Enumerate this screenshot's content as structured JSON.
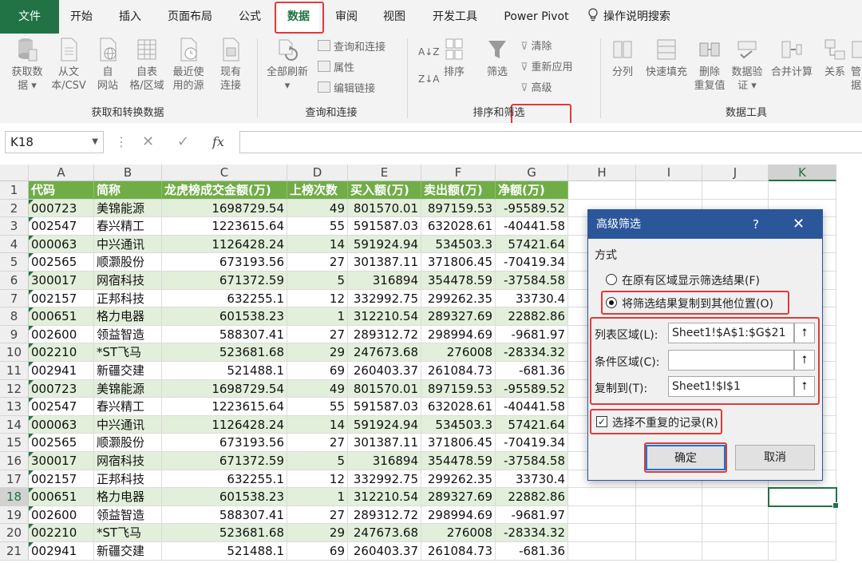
{
  "menu": {
    "items": [
      "文件",
      "开始",
      "插入",
      "页面布局",
      "公式",
      "数据",
      "审阅",
      "视图",
      "开发工具",
      "Power Pivot"
    ],
    "search_label": "操作说明搜索",
    "active": "数据"
  },
  "ribbon": {
    "get_transform": {
      "buttons": [
        {
          "line1": "获取数",
          "line2": "据 ▾"
        },
        {
          "line1": "从文",
          "line2": "本/CSV"
        },
        {
          "line1": "自",
          "line2": "网站"
        },
        {
          "line1": "自表",
          "line2": "格/区域"
        },
        {
          "line1": "最近使",
          "line2": "用的源"
        },
        {
          "line1": "现有",
          "line2": "连接"
        }
      ],
      "label": "获取和转换数据"
    },
    "queries": {
      "refresh": {
        "line1": "全部刷新",
        "line2": "▾"
      },
      "small": [
        "查询和连接",
        "属性",
        "编辑链接"
      ],
      "label": "查询和连接"
    },
    "sort_filter": {
      "sort_asc": "A↓Z",
      "sort_desc": "Z↓A",
      "sort": "排序",
      "filter": "筛选",
      "clear": "清除",
      "reapply": "重新应用",
      "advanced": "高级",
      "label": "排序和筛选"
    },
    "data_tools": {
      "buttons": [
        {
          "line1": "分列",
          "line2": ""
        },
        {
          "line1": "快速填充",
          "line2": ""
        },
        {
          "line1": "删除",
          "line2": "重复值"
        },
        {
          "line1": "数据验",
          "line2": "证 ▾"
        },
        {
          "line1": "合并计算",
          "line2": ""
        },
        {
          "line1": "关系",
          "line2": ""
        },
        {
          "line1": "管",
          "line2": "据"
        }
      ],
      "label": "数据工具"
    }
  },
  "formula_bar": {
    "name_box": "K18",
    "fx": "fx",
    "cancel": "✕",
    "enter": "✓",
    "dots": "⋮",
    "value": ""
  },
  "sheet": {
    "columns": [
      "A",
      "B",
      "C",
      "D",
      "E",
      "F",
      "G",
      "H",
      "I",
      "J",
      "K"
    ],
    "row_numbers": [
      "1",
      "2",
      "3",
      "4",
      "5",
      "6",
      "7",
      "8",
      "9",
      "10",
      "11",
      "12",
      "13",
      "14",
      "15",
      "16",
      "17",
      "18",
      "19",
      "20",
      "21"
    ],
    "header": [
      "代码",
      "简称",
      "龙虎榜成交金额(万)",
      "上榜次数",
      "买入额(万)",
      "卖出额(万)",
      "净额(万)"
    ],
    "rows": [
      [
        "000723",
        "美锦能源",
        "1698729.54",
        "49",
        "801570.01",
        "897159.53",
        "-95589.52"
      ],
      [
        "002547",
        "春兴精工",
        "1223615.64",
        "55",
        "591587.03",
        "632028.61",
        "-40441.58"
      ],
      [
        "000063",
        "中兴通讯",
        "1126428.24",
        "14",
        "591924.94",
        "534503.3",
        "57421.64"
      ],
      [
        "002565",
        "顺灏股份",
        "673193.56",
        "27",
        "301387.11",
        "371806.45",
        "-70419.34"
      ],
      [
        "300017",
        "网宿科技",
        "671372.59",
        "5",
        "316894",
        "354478.59",
        "-37584.58"
      ],
      [
        "002157",
        "正邦科技",
        "632255.1",
        "12",
        "332992.75",
        "299262.35",
        "33730.4"
      ],
      [
        "000651",
        "格力电器",
        "601538.23",
        "1",
        "312210.54",
        "289327.69",
        "22882.86"
      ],
      [
        "002600",
        "领益智造",
        "588307.41",
        "27",
        "289312.72",
        "298994.69",
        "-9681.97"
      ],
      [
        "002210",
        "*ST飞马",
        "523681.68",
        "29",
        "247673.68",
        "276008",
        "-28334.32"
      ],
      [
        "002941",
        "新疆交建",
        "521488.1",
        "69",
        "260403.37",
        "261084.73",
        "-681.36"
      ],
      [
        "000723",
        "美锦能源",
        "1698729.54",
        "49",
        "801570.01",
        "897159.53",
        "-95589.52"
      ],
      [
        "002547",
        "春兴精工",
        "1223615.64",
        "55",
        "591587.03",
        "632028.61",
        "-40441.58"
      ],
      [
        "000063",
        "中兴通讯",
        "1126428.24",
        "14",
        "591924.94",
        "534503.3",
        "57421.64"
      ],
      [
        "002565",
        "顺灏股份",
        "673193.56",
        "27",
        "301387.11",
        "371806.45",
        "-70419.34"
      ],
      [
        "300017",
        "网宿科技",
        "671372.59",
        "5",
        "316894",
        "354478.59",
        "-37584.58"
      ],
      [
        "002157",
        "正邦科技",
        "632255.1",
        "12",
        "332992.75",
        "299262.35",
        "33730.4"
      ],
      [
        "000651",
        "格力电器",
        "601538.23",
        "1",
        "312210.54",
        "289327.69",
        "22882.86"
      ],
      [
        "002600",
        "领益智造",
        "588307.41",
        "27",
        "289312.72",
        "298994.69",
        "-9681.97"
      ],
      [
        "002210",
        "*ST飞马",
        "523681.68",
        "29",
        "247673.68",
        "276008",
        "-28334.32"
      ],
      [
        "002941",
        "新疆交建",
        "521488.1",
        "69",
        "260403.37",
        "261084.73",
        "-681.36"
      ]
    ],
    "selected_cell": "K18",
    "header_fill": "#70ad47",
    "band_fill": "#e2efda"
  },
  "dialog": {
    "title": "高级筛选",
    "help": "?",
    "close": "✕",
    "section": "方式",
    "option_in_place": "在原有区域显示筛选结果(F)",
    "option_copy": "将筛选结果复制到其他位置(O)",
    "list_range_label": "列表区域(L):",
    "list_range_value": "Sheet1!$A$1:$G$21",
    "criteria_label": "条件区域(C):",
    "criteria_value": "",
    "copy_to_label": "复制到(T):",
    "copy_to_value": "Sheet1!$I$1",
    "unique_label": "选择不重复的记录(R)",
    "ok": "确定",
    "cancel": "取消",
    "ref_icon": "⭡"
  },
  "colors": {
    "excel_green": "#217346",
    "dialog_blue": "#2b579a",
    "highlight_red": "#e03a3a"
  }
}
